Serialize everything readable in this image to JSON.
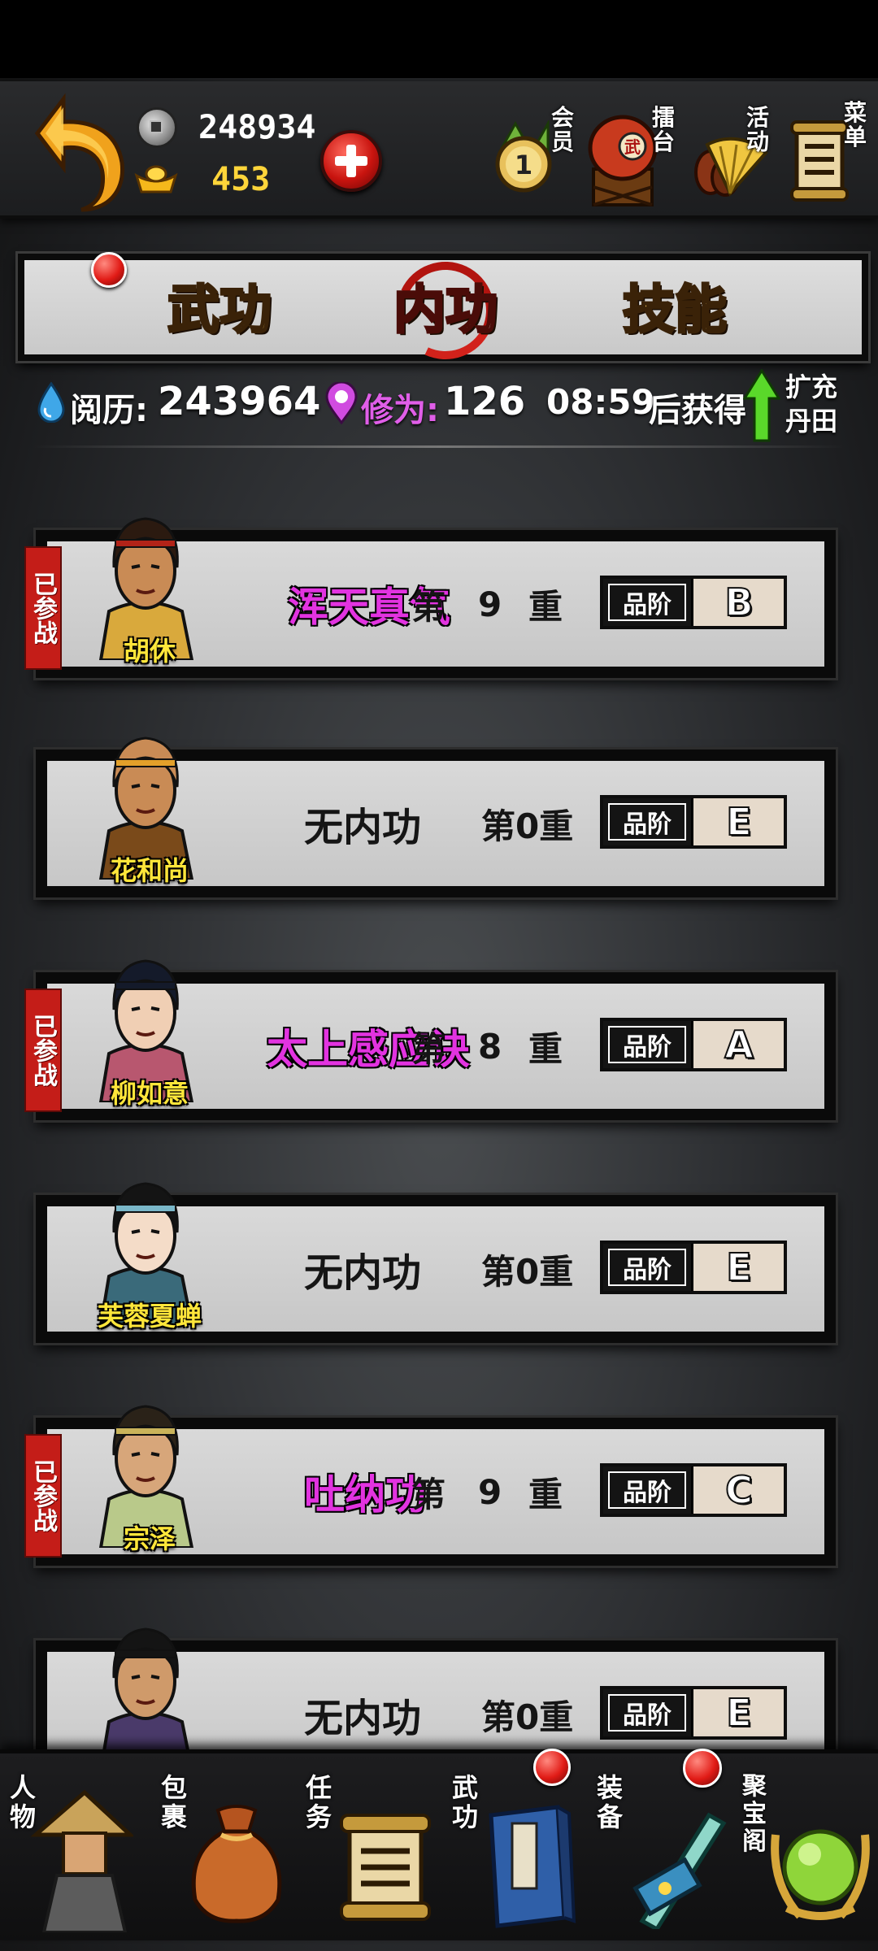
{
  "currency": {
    "silver": "248934",
    "gold": "453"
  },
  "top_menu": [
    {
      "id": "vip",
      "label": "会员"
    },
    {
      "id": "arena",
      "label": "擂台"
    },
    {
      "id": "event",
      "label": "活动"
    },
    {
      "id": "menu",
      "label": "菜单"
    }
  ],
  "tabs": [
    {
      "label": "武功",
      "active": false,
      "badge": true
    },
    {
      "label": "内功",
      "active": true,
      "badge": false
    },
    {
      "label": "技能",
      "active": false,
      "badge": false
    }
  ],
  "stats": {
    "exp_label": "阅历:",
    "exp_value": "243964",
    "cult_label": "修为:",
    "cult_value": "126",
    "timer": "08:59",
    "timer_suffix": "后获得",
    "expand_label_1": "扩充",
    "expand_label_2": "丹田"
  },
  "heroes": [
    {
      "name": "胡休",
      "joined_label": "已参战",
      "joined": true,
      "skill": "浑天真气",
      "level_prefix": "第",
      "level": "9",
      "level_suffix": "重",
      "grade_label": "品阶",
      "grade": "B"
    },
    {
      "name": "花和尚",
      "joined_label": "",
      "joined": false,
      "skill": "无内功",
      "level_prefix": "",
      "level": "第0重",
      "level_suffix": "",
      "grade_label": "品阶",
      "grade": "E"
    },
    {
      "name": "柳如意",
      "joined_label": "已参战",
      "joined": true,
      "skill": "太上感应诀",
      "level_prefix": "第",
      "level": "8",
      "level_suffix": "重",
      "grade_label": "品阶",
      "grade": "A"
    },
    {
      "name": "芙蓉夏蝉",
      "joined_label": "",
      "joined": false,
      "skill": "无内功",
      "level_prefix": "",
      "level": "第0重",
      "level_suffix": "",
      "grade_label": "品阶",
      "grade": "E"
    },
    {
      "name": "宗泽",
      "joined_label": "已参战",
      "joined": true,
      "skill": "吐纳功",
      "level_prefix": "第",
      "level": "9",
      "level_suffix": "重",
      "grade_label": "品阶",
      "grade": "C"
    },
    {
      "name": "",
      "joined_label": "",
      "joined": false,
      "skill": "无内功",
      "level_prefix": "",
      "level": "第0重",
      "level_suffix": "",
      "grade_label": "品阶",
      "grade": "E"
    }
  ],
  "bottom_nav": [
    {
      "label": "人物",
      "badge": false
    },
    {
      "label": "包裹",
      "badge": false
    },
    {
      "label": "任务",
      "badge": false
    },
    {
      "label": "武功",
      "badge": true
    },
    {
      "label": "装备",
      "badge": true
    },
    {
      "label": "聚宝阁",
      "badge": false
    }
  ],
  "colors": {
    "skill_named": "#e233e0",
    "hero_name": "#ffe63a",
    "tab_text": "#ecc25a",
    "badge_red": "#e11b16",
    "joined_red": "#c41d18"
  }
}
